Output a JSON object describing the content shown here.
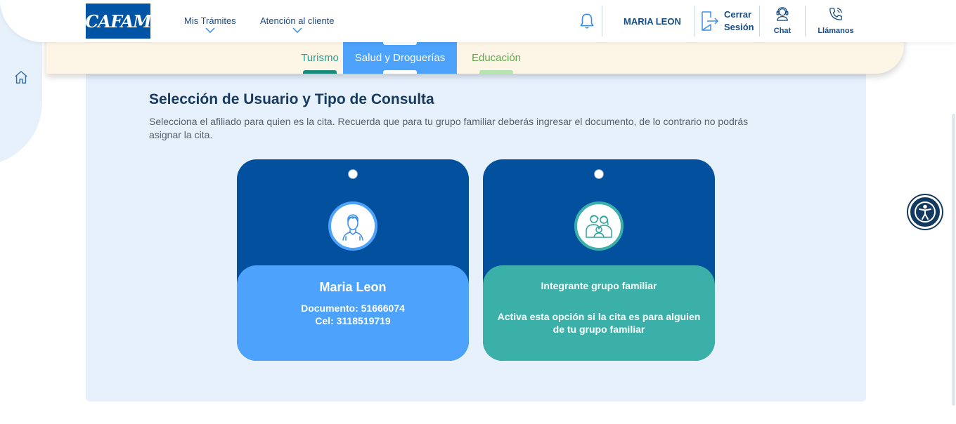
{
  "header": {
    "logo_text": "CAFAM",
    "nav": [
      {
        "label": "Mis Trámites"
      },
      {
        "label": "Atención al cliente"
      }
    ],
    "user_name": "MARIA LEON",
    "logout_line1": "Cerrar",
    "logout_line2": "Sesión",
    "chat_label": "Chat",
    "call_label": "Llámanos"
  },
  "tabs": [
    {
      "label": "Turismo"
    },
    {
      "label": "Salud y Droguerías",
      "active": true
    },
    {
      "label": "Educación"
    }
  ],
  "section": {
    "title": "Selección de Usuario y Tipo de Consulta",
    "description": "Selecciona el afiliado para quien es la cita. Recuerda que para tu grupo familiar deberás ingresar el documento, de lo contrario no podrás asignar la cita."
  },
  "cards": {
    "user": {
      "name": "Maria Leon",
      "document": "Documento: 51666074",
      "cel": "Cel: 3118519719"
    },
    "family": {
      "title": "Integrante grupo familiar",
      "description": "Activa esta opción si la cita es para alguien de tu grupo familiar"
    }
  },
  "icons": {
    "home": "home-icon",
    "bell": "bell-icon",
    "logout": "logout-icon",
    "chat": "headset-icon",
    "call": "phone-icon",
    "user_avatar": "person-icon",
    "family_avatar": "family-icon",
    "accessibility": "accessibility-icon"
  },
  "colors": {
    "brand_blue": "#0054a6",
    "card_dark": "#03509e",
    "card_light": "#4da2fb",
    "card_teal": "#3ab0a8",
    "panel_bg": "#e6f1fc"
  }
}
